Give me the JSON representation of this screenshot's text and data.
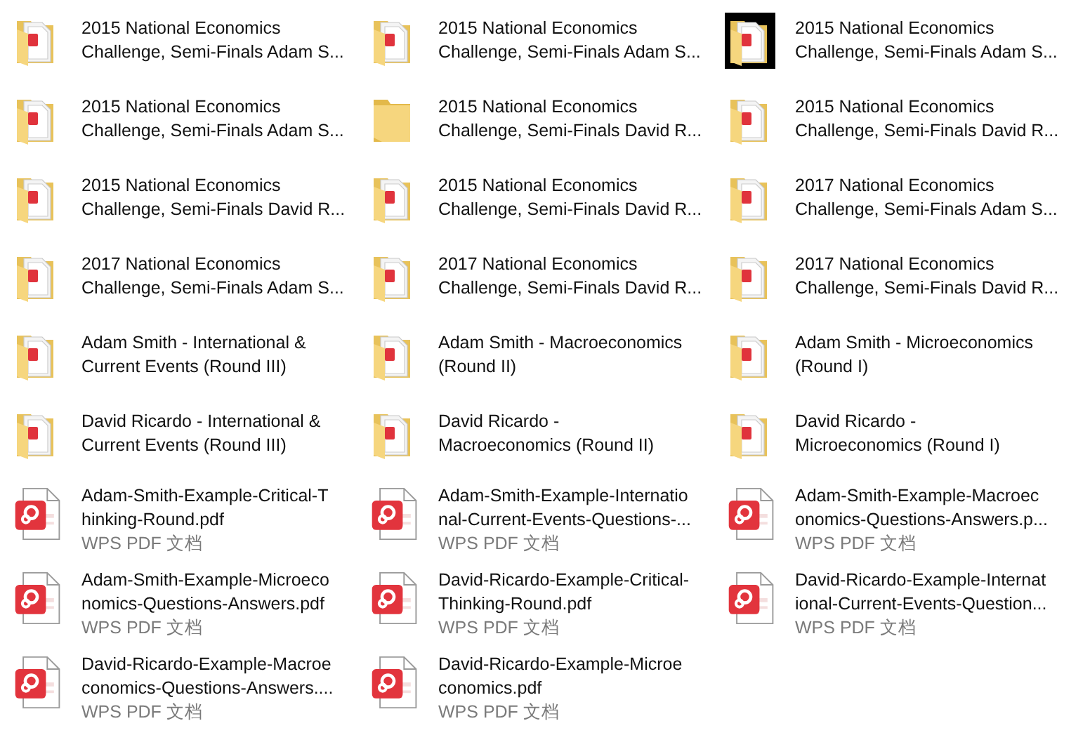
{
  "files": [
    {
      "kind": "pdf-folder",
      "lines": [
        "2015 National Economics",
        "Challenge, Semi-Finals Adam S..."
      ]
    },
    {
      "kind": "pdf-folder",
      "lines": [
        "2015 National Economics",
        "Challenge, Semi-Finals Adam S..."
      ]
    },
    {
      "kind": "pdf-folder-dark",
      "lines": [
        "2015 National Economics",
        "Challenge, Semi-Finals Adam S..."
      ]
    },
    {
      "kind": "pdf-folder",
      "lines": [
        "2015 National Economics",
        "Challenge, Semi-Finals Adam S..."
      ]
    },
    {
      "kind": "folder",
      "lines": [
        "2015 National Economics",
        "Challenge, Semi-Finals David R..."
      ]
    },
    {
      "kind": "pdf-folder",
      "lines": [
        "2015 National Economics",
        "Challenge, Semi-Finals David R..."
      ]
    },
    {
      "kind": "pdf-folder",
      "lines": [
        "2015 National Economics",
        "Challenge, Semi-Finals David R..."
      ]
    },
    {
      "kind": "pdf-folder",
      "lines": [
        "2015 National Economics",
        "Challenge, Semi-Finals David R..."
      ]
    },
    {
      "kind": "pdf-folder",
      "lines": [
        "2017 National Economics",
        "Challenge, Semi-Finals Adam S..."
      ]
    },
    {
      "kind": "pdf-folder",
      "lines": [
        "2017 National Economics",
        "Challenge, Semi-Finals Adam S..."
      ]
    },
    {
      "kind": "pdf-folder",
      "lines": [
        "2017 National Economics",
        "Challenge, Semi-Finals David R..."
      ]
    },
    {
      "kind": "pdf-folder",
      "lines": [
        "2017 National Economics",
        "Challenge, Semi-Finals David R..."
      ]
    },
    {
      "kind": "pdf-folder",
      "lines": [
        "Adam Smith - International &",
        "Current Events (Round III)"
      ]
    },
    {
      "kind": "pdf-folder",
      "lines": [
        "Adam Smith - Macroeconomics",
        "(Round II)"
      ]
    },
    {
      "kind": "pdf-folder",
      "lines": [
        "Adam Smith - Microeconomics",
        "(Round I)"
      ]
    },
    {
      "kind": "pdf-folder",
      "lines": [
        "David Ricardo - International &",
        "Current Events (Round III)"
      ]
    },
    {
      "kind": "pdf-folder",
      "lines": [
        "David Ricardo -",
        "Macroeconomics (Round II)"
      ]
    },
    {
      "kind": "pdf-folder",
      "lines": [
        "David Ricardo -",
        "Microeconomics (Round I)"
      ]
    },
    {
      "kind": "pdf",
      "lines": [
        "Adam-Smith-Example-Critical-T",
        "hinking-Round.pdf"
      ],
      "type": "WPS PDF 文档"
    },
    {
      "kind": "pdf",
      "lines": [
        "Adam-Smith-Example-Internatio",
        "nal-Current-Events-Questions-..."
      ],
      "type": "WPS PDF 文档"
    },
    {
      "kind": "pdf",
      "lines": [
        "Adam-Smith-Example-Macroec",
        "onomics-Questions-Answers.p..."
      ],
      "type": "WPS PDF 文档"
    },
    {
      "kind": "pdf",
      "lines": [
        "Adam-Smith-Example-Microeco",
        "nomics-Questions-Answers.pdf"
      ],
      "type": "WPS PDF 文档"
    },
    {
      "kind": "pdf",
      "lines": [
        "David-Ricardo-Example-Critical-",
        "Thinking-Round.pdf"
      ],
      "type": "WPS PDF 文档"
    },
    {
      "kind": "pdf",
      "lines": [
        "David-Ricardo-Example-Internat",
        "ional-Current-Events-Question..."
      ],
      "type": "WPS PDF 文档"
    },
    {
      "kind": "pdf",
      "lines": [
        "David-Ricardo-Example-Macroe",
        "conomics-Questions-Answers...."
      ],
      "type": "WPS PDF 文档"
    },
    {
      "kind": "pdf",
      "lines": [
        "David-Ricardo-Example-Microe",
        "conomics.pdf"
      ],
      "type": "WPS PDF 文档"
    }
  ]
}
